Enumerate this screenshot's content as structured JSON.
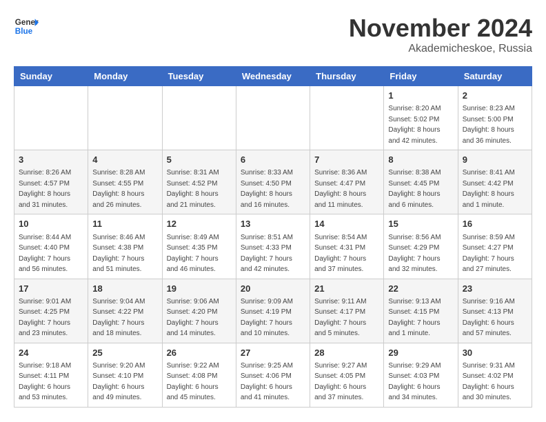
{
  "header": {
    "logo_line1": "General",
    "logo_line2": "Blue",
    "month_title": "November 2024",
    "location": "Akademicheskoe, Russia"
  },
  "days_of_week": [
    "Sunday",
    "Monday",
    "Tuesday",
    "Wednesday",
    "Thursday",
    "Friday",
    "Saturday"
  ],
  "weeks": [
    [
      {
        "day": "",
        "info": ""
      },
      {
        "day": "",
        "info": ""
      },
      {
        "day": "",
        "info": ""
      },
      {
        "day": "",
        "info": ""
      },
      {
        "day": "",
        "info": ""
      },
      {
        "day": "1",
        "info": "Sunrise: 8:20 AM\nSunset: 5:02 PM\nDaylight: 8 hours and 42 minutes."
      },
      {
        "day": "2",
        "info": "Sunrise: 8:23 AM\nSunset: 5:00 PM\nDaylight: 8 hours and 36 minutes."
      }
    ],
    [
      {
        "day": "3",
        "info": "Sunrise: 8:26 AM\nSunset: 4:57 PM\nDaylight: 8 hours and 31 minutes."
      },
      {
        "day": "4",
        "info": "Sunrise: 8:28 AM\nSunset: 4:55 PM\nDaylight: 8 hours and 26 minutes."
      },
      {
        "day": "5",
        "info": "Sunrise: 8:31 AM\nSunset: 4:52 PM\nDaylight: 8 hours and 21 minutes."
      },
      {
        "day": "6",
        "info": "Sunrise: 8:33 AM\nSunset: 4:50 PM\nDaylight: 8 hours and 16 minutes."
      },
      {
        "day": "7",
        "info": "Sunrise: 8:36 AM\nSunset: 4:47 PM\nDaylight: 8 hours and 11 minutes."
      },
      {
        "day": "8",
        "info": "Sunrise: 8:38 AM\nSunset: 4:45 PM\nDaylight: 8 hours and 6 minutes."
      },
      {
        "day": "9",
        "info": "Sunrise: 8:41 AM\nSunset: 4:42 PM\nDaylight: 8 hours and 1 minute."
      }
    ],
    [
      {
        "day": "10",
        "info": "Sunrise: 8:44 AM\nSunset: 4:40 PM\nDaylight: 7 hours and 56 minutes."
      },
      {
        "day": "11",
        "info": "Sunrise: 8:46 AM\nSunset: 4:38 PM\nDaylight: 7 hours and 51 minutes."
      },
      {
        "day": "12",
        "info": "Sunrise: 8:49 AM\nSunset: 4:35 PM\nDaylight: 7 hours and 46 minutes."
      },
      {
        "day": "13",
        "info": "Sunrise: 8:51 AM\nSunset: 4:33 PM\nDaylight: 7 hours and 42 minutes."
      },
      {
        "day": "14",
        "info": "Sunrise: 8:54 AM\nSunset: 4:31 PM\nDaylight: 7 hours and 37 minutes."
      },
      {
        "day": "15",
        "info": "Sunrise: 8:56 AM\nSunset: 4:29 PM\nDaylight: 7 hours and 32 minutes."
      },
      {
        "day": "16",
        "info": "Sunrise: 8:59 AM\nSunset: 4:27 PM\nDaylight: 7 hours and 27 minutes."
      }
    ],
    [
      {
        "day": "17",
        "info": "Sunrise: 9:01 AM\nSunset: 4:25 PM\nDaylight: 7 hours and 23 minutes."
      },
      {
        "day": "18",
        "info": "Sunrise: 9:04 AM\nSunset: 4:22 PM\nDaylight: 7 hours and 18 minutes."
      },
      {
        "day": "19",
        "info": "Sunrise: 9:06 AM\nSunset: 4:20 PM\nDaylight: 7 hours and 14 minutes."
      },
      {
        "day": "20",
        "info": "Sunrise: 9:09 AM\nSunset: 4:19 PM\nDaylight: 7 hours and 10 minutes."
      },
      {
        "day": "21",
        "info": "Sunrise: 9:11 AM\nSunset: 4:17 PM\nDaylight: 7 hours and 5 minutes."
      },
      {
        "day": "22",
        "info": "Sunrise: 9:13 AM\nSunset: 4:15 PM\nDaylight: 7 hours and 1 minute."
      },
      {
        "day": "23",
        "info": "Sunrise: 9:16 AM\nSunset: 4:13 PM\nDaylight: 6 hours and 57 minutes."
      }
    ],
    [
      {
        "day": "24",
        "info": "Sunrise: 9:18 AM\nSunset: 4:11 PM\nDaylight: 6 hours and 53 minutes."
      },
      {
        "day": "25",
        "info": "Sunrise: 9:20 AM\nSunset: 4:10 PM\nDaylight: 6 hours and 49 minutes."
      },
      {
        "day": "26",
        "info": "Sunrise: 9:22 AM\nSunset: 4:08 PM\nDaylight: 6 hours and 45 minutes."
      },
      {
        "day": "27",
        "info": "Sunrise: 9:25 AM\nSunset: 4:06 PM\nDaylight: 6 hours and 41 minutes."
      },
      {
        "day": "28",
        "info": "Sunrise: 9:27 AM\nSunset: 4:05 PM\nDaylight: 6 hours and 37 minutes."
      },
      {
        "day": "29",
        "info": "Sunrise: 9:29 AM\nSunset: 4:03 PM\nDaylight: 6 hours and 34 minutes."
      },
      {
        "day": "30",
        "info": "Sunrise: 9:31 AM\nSunset: 4:02 PM\nDaylight: 6 hours and 30 minutes."
      }
    ]
  ]
}
